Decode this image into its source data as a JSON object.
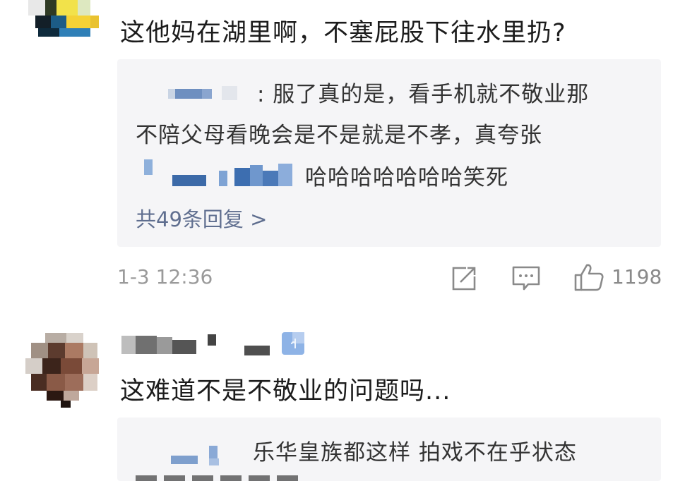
{
  "comment1": {
    "text": "这他妈在湖里啊，不塞屁股下往水里扔?",
    "replies": [
      {
        "suffix": ": 服了真的是，看手机就不敬业那"
      },
      {
        "continuation": "不陪父母看晚会是不是就是不孝，真夸张"
      },
      {
        "suffix": "哈哈哈哈哈哈哈笑死"
      }
    ],
    "more_replies": "共49条回复 >",
    "timestamp": "1-3 12:36",
    "actions": {
      "share_icon": "share-icon",
      "comment_icon": "comment-icon",
      "like_icon": "thumbs-up-icon",
      "like_count": "1198"
    }
  },
  "comment2": {
    "text": "这难道不是不敬业的问题吗...",
    "replies": [
      {
        "suffix": "乐华皇族都这样 拍戏不在乎状态"
      }
    ]
  },
  "colors": {
    "reply_bg": "#f5f5f7",
    "link": "#5f6e8f",
    "meta": "#9a9a9a",
    "badge": "#8eb3e6"
  }
}
